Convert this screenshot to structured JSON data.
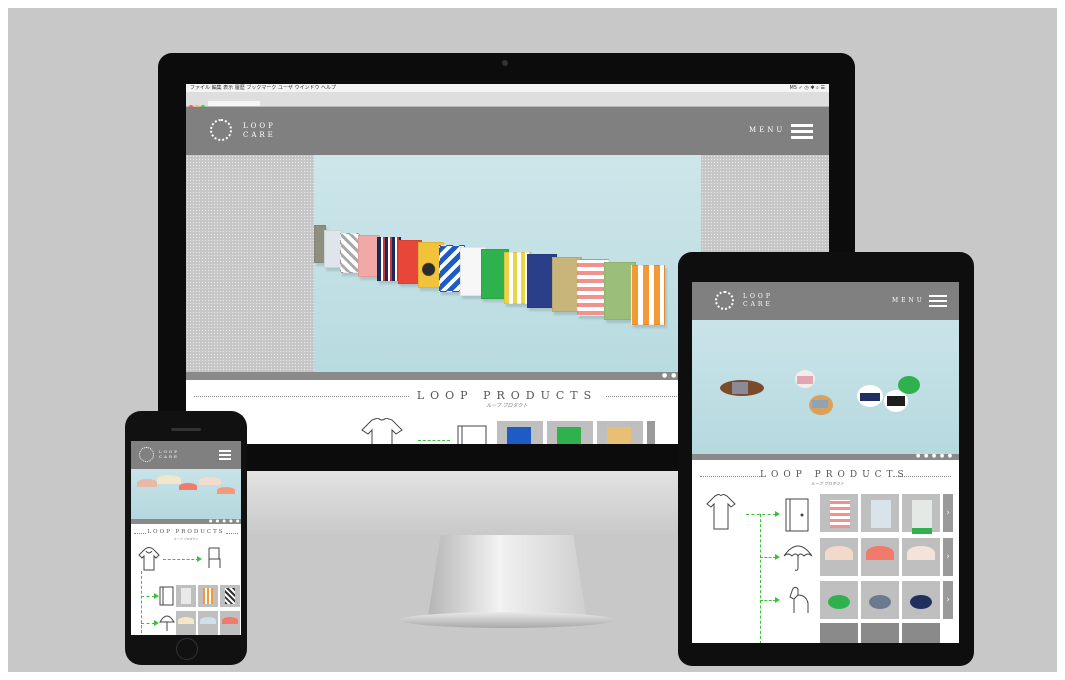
{
  "site": {
    "logo_line1": "LOOP",
    "logo_line2": "CARE",
    "menu_label": "MENU"
  },
  "browser": {
    "menubar_left": "ファイル  編集  表示  履歴  ブックマーク  ユーザ  ウインドウ  ヘルプ",
    "menubar_right": "M5  ✓  ◷  ✱  ⌕  ☰"
  },
  "products": {
    "heading": "LOOP PRODUCTS",
    "subheading": "ループ プロダクト"
  },
  "icons": {
    "menu": "hamburger-icon",
    "next": "chevron-right-icon",
    "logo": "dotted-ring-logo-icon",
    "shirt": "shirt-outline-icon",
    "umbrella": "umbrella-outline-icon",
    "dog": "dog-outline-icon",
    "folder": "binder-outline-icon",
    "hoodie": "hoodie-outline-icon",
    "chair": "chair-outline-icon"
  },
  "colors": {
    "background": "#c8c8c8",
    "header_gray": "#808080",
    "accent_green": "#39c03f",
    "hero_blue": "#cde6ea"
  },
  "slider": {
    "dots_symbol": "● ● ● ● ●"
  },
  "next_symbol": "›"
}
